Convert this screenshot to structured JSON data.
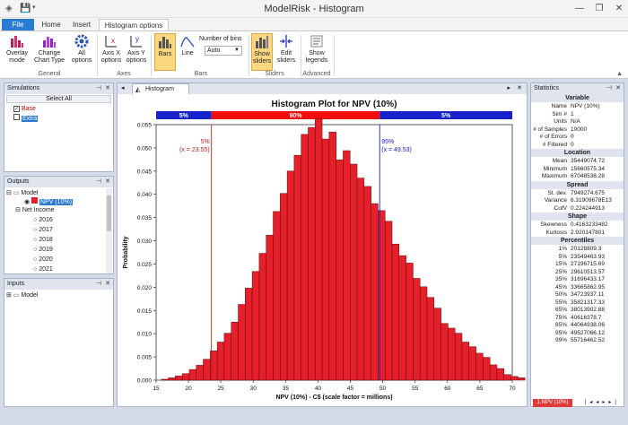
{
  "window": {
    "title": "ModelRisk - Histogram",
    "minimize": "—",
    "restore": "❐",
    "close": "✕"
  },
  "tabs": [
    "File",
    "Home",
    "Insert",
    "Histogram options"
  ],
  "ribbon": {
    "buttons": {
      "overlay": "Overlay mode",
      "change_chart": "Change Chart Type",
      "all_options": "All options",
      "axis_x": "Axis X options",
      "axis_y": "Axis Y options",
      "bars": "Bars",
      "line": "Line",
      "show_sliders": "Show sliders",
      "edit_sliders": "Edit sliders",
      "show_legends": "Show legends"
    },
    "groups": {
      "general": "General",
      "axes": "Axes",
      "bars": "Bars",
      "sliders": "Sliders",
      "advanced": "Advanced"
    },
    "bins_label": "Number of bins",
    "bins_value": "Auto"
  },
  "simulations": {
    "title": "Simulations",
    "select_all": "Select All",
    "items": [
      {
        "label": "Base",
        "color": "#cc0000",
        "checked": true
      },
      {
        "label": "Extra",
        "color": "#2b7bd2",
        "checked": false
      }
    ]
  },
  "outputs": {
    "title": "Outputs",
    "model": "Model",
    "npv": "NPV (10%)",
    "net_income": "Net Income",
    "years": [
      "2016",
      "2017",
      "2018",
      "2019",
      "2020",
      "2021"
    ]
  },
  "inputs": {
    "title": "Inputs",
    "model": "Model"
  },
  "doc_tab": "Histogram",
  "chart_data": {
    "type": "bar",
    "title": "Histogram Plot for NPV (10%)",
    "xlabel": "NPV (10%) - C$ (scale factor = millions)",
    "ylabel": "Probability",
    "xlim": [
      15,
      70
    ],
    "ylim": [
      0,
      0.055
    ],
    "xticks": [
      15,
      20,
      25,
      30,
      35,
      40,
      45,
      50,
      55,
      60,
      65,
      70
    ],
    "yticks": [
      0.0,
      0.005,
      0.01,
      0.015,
      0.02,
      0.025,
      0.03,
      0.035,
      0.04,
      0.045,
      0.05,
      0.055
    ],
    "bin_start": 15.8,
    "bin_width": 1.08,
    "values": [
      0.0002,
      0.0005,
      0.0009,
      0.0014,
      0.0023,
      0.0032,
      0.0045,
      0.0063,
      0.0082,
      0.0101,
      0.0125,
      0.0163,
      0.0198,
      0.0234,
      0.0273,
      0.0312,
      0.0363,
      0.0402,
      0.045,
      0.0484,
      0.0529,
      0.0544,
      0.0562,
      0.0519,
      0.0534,
      0.0474,
      0.0494,
      0.0465,
      0.0435,
      0.0417,
      0.038,
      0.0365,
      0.0342,
      0.0293,
      0.0268,
      0.0252,
      0.0219,
      0.0201,
      0.0178,
      0.0155,
      0.0122,
      0.0112,
      0.0101,
      0.0082,
      0.0072,
      0.0058,
      0.0049,
      0.0033,
      0.0025,
      0.0012,
      0.0008,
      0.0005
    ],
    "bar_color": "#e5202a",
    "lower_slider": {
      "value": 23.55,
      "percent": "5%",
      "label": "(x = 23.55)"
    },
    "upper_slider": {
      "value": 49.53,
      "percent": "95%",
      "label": "(x = 49.53)"
    },
    "bands": [
      {
        "label": "5%",
        "color": "#1722c8"
      },
      {
        "label": "90%",
        "color": "#f20d0d"
      },
      {
        "label": "5%",
        "color": "#1722c8"
      }
    ]
  },
  "stats": {
    "title": "Statistics",
    "sections": [
      {
        "header": "Variable",
        "rows": [
          [
            "Name",
            "NPV (10%)"
          ],
          [
            "Sim #",
            "1"
          ],
          [
            "Units",
            "N/A"
          ],
          [
            "# of Samples",
            "10000"
          ],
          [
            "# of Errors",
            "0"
          ],
          [
            "# Filtered",
            "0"
          ]
        ]
      },
      {
        "header": "Location",
        "rows": [
          [
            "Mean",
            "35449074.72"
          ],
          [
            "Minimum",
            "15660575.34"
          ],
          [
            "Maximum",
            "67048538.28"
          ]
        ]
      },
      {
        "header": "Spread",
        "rows": [
          [
            "St. dev.",
            "7949274.675"
          ],
          [
            "Variance",
            "6.31909678E13"
          ],
          [
            "CofV",
            "0.224244913"
          ]
        ]
      },
      {
        "header": "Shape",
        "rows": [
          [
            "Skewness",
            "0.4163233482"
          ],
          [
            "Kurtosis",
            "2.920147801"
          ]
        ]
      },
      {
        "header": "Percentiles",
        "rows": [
          [
            "1%",
            "20128809.3"
          ],
          [
            "5%",
            "23549463.93"
          ],
          [
            "15%",
            "27196715.69"
          ],
          [
            "25%",
            "29610513.57"
          ],
          [
            "35%",
            "31696433.17"
          ],
          [
            "45%",
            "33665862.95"
          ],
          [
            "50%",
            "34723937.11"
          ],
          [
            "55%",
            "35821317.33"
          ],
          [
            "65%",
            "38013902.88"
          ],
          [
            "75%",
            "40616378.7"
          ],
          [
            "85%",
            "44064938.06"
          ],
          [
            "95%",
            "49527066.12"
          ],
          [
            "99%",
            "55716462.52"
          ]
        ]
      }
    ],
    "tab_label": "1.NPV (10%)"
  }
}
